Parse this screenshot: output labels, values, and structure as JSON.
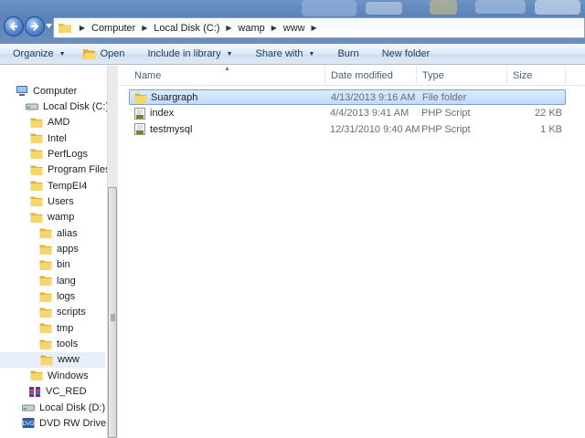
{
  "address": {
    "crumbs": [
      "Computer",
      "Local Disk (C:)",
      "wamp",
      "www"
    ]
  },
  "toolbar": {
    "organize": "Organize",
    "open": "Open",
    "include_in_library": "Include in library",
    "share_with": "Share with",
    "burn": "Burn",
    "new_folder": "New folder"
  },
  "nav": {
    "items": [
      {
        "label": "Computer",
        "icon": "computer-icon"
      },
      {
        "label": "Local Disk (C:)",
        "icon": "drive-icon"
      },
      {
        "label": "AMD",
        "icon": "folder-icon"
      },
      {
        "label": "Intel",
        "icon": "folder-icon"
      },
      {
        "label": "PerfLogs",
        "icon": "folder-icon"
      },
      {
        "label": "Program Files",
        "icon": "folder-icon"
      },
      {
        "label": "TempEI4",
        "icon": "folder-icon"
      },
      {
        "label": "Users",
        "icon": "folder-icon"
      },
      {
        "label": "wamp",
        "icon": "folder-icon"
      },
      {
        "label": "alias",
        "icon": "folder-icon"
      },
      {
        "label": "apps",
        "icon": "folder-icon"
      },
      {
        "label": "bin",
        "icon": "folder-icon"
      },
      {
        "label": "lang",
        "icon": "folder-icon"
      },
      {
        "label": "logs",
        "icon": "folder-icon"
      },
      {
        "label": "scripts",
        "icon": "folder-icon"
      },
      {
        "label": "tmp",
        "icon": "folder-icon"
      },
      {
        "label": "tools",
        "icon": "folder-icon"
      },
      {
        "label": "www",
        "icon": "folder-icon"
      },
      {
        "label": "Windows",
        "icon": "folder-icon"
      },
      {
        "label": "VC_RED",
        "icon": "archive-icon"
      },
      {
        "label": "Local Disk (D:)",
        "icon": "drive-icon"
      },
      {
        "label": "DVD RW Drive (E:",
        "icon": "dvd-drive-icon"
      }
    ]
  },
  "columns": {
    "name": "Name",
    "date_modified": "Date modified",
    "type": "Type",
    "size": "Size"
  },
  "files": [
    {
      "name": "Suargraph",
      "date": "4/13/2013 9:16 AM",
      "type": "File folder",
      "size": "",
      "icon": "folder-icon",
      "selected": true
    },
    {
      "name": "index",
      "date": "4/4/2013 9:41 AM",
      "type": "PHP Script",
      "size": "22 KB",
      "icon": "php-script-icon",
      "selected": false
    },
    {
      "name": "testmysql",
      "date": "12/31/2010 9:40 AM",
      "type": "PHP Script",
      "size": "1 KB",
      "icon": "php-script-icon",
      "selected": false
    }
  ],
  "colors": {
    "selection_bg": "#cce0fa",
    "selection_border": "#7da2ce",
    "toolbar_text": "#1e395b",
    "header_text": "#4c607a",
    "folder": "#f2c94c"
  }
}
